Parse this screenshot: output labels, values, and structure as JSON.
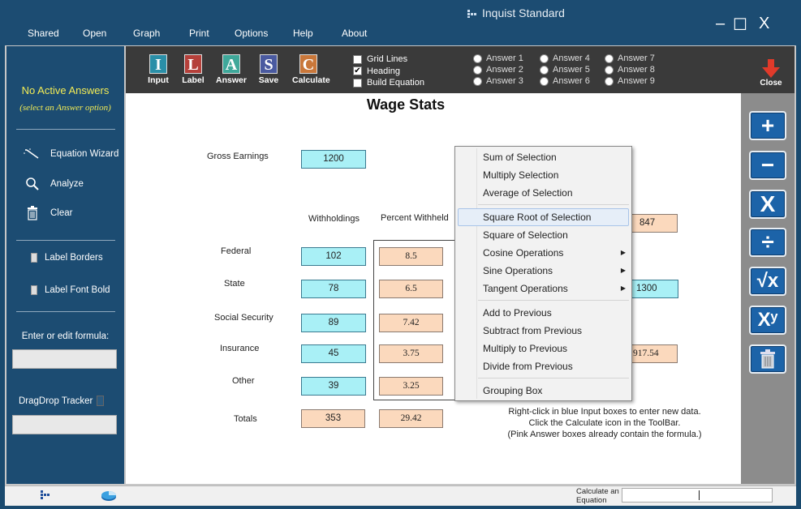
{
  "window": {
    "title": "Inquist Standard",
    "controls": {
      "minimize": "–",
      "maximize": "☐",
      "close": "X"
    }
  },
  "menu": [
    "Shared",
    "Open",
    "Graph",
    "Print",
    "Options",
    "Help",
    "About"
  ],
  "left_panel": {
    "status": "No Active Answers",
    "hint": "(select an Answer option)",
    "tools": [
      "Equation Wizard",
      "Analyze",
      "Clear"
    ],
    "toggles": [
      "Label Borders",
      "Label Font Bold"
    ],
    "formula_label": "Enter or edit formula:",
    "formula_value": "",
    "dragdrop_label": "DragDrop Tracker",
    "dragdrop_value": ""
  },
  "toolbar": {
    "tools": [
      {
        "letter": "I",
        "label": "Input",
        "color": "#2a8fa8"
      },
      {
        "letter": "L",
        "label": "Label",
        "color": "#b5403a"
      },
      {
        "letter": "A",
        "label": "Answer",
        "color": "#3fa89a"
      },
      {
        "letter": "S",
        "label": "Save",
        "color": "#4a5aa0"
      },
      {
        "letter": "C",
        "label": "Calculate",
        "color": "#c9773a"
      }
    ],
    "options": [
      {
        "label": "Grid Lines",
        "checked": false
      },
      {
        "label": "Heading",
        "checked": true
      },
      {
        "label": "Build Equation",
        "checked": false
      }
    ],
    "answers": [
      "Answer 1",
      "Answer 2",
      "Answer 3",
      "Answer 4",
      "Answer 5",
      "Answer 6",
      "Answer 7",
      "Answer 8",
      "Answer 9"
    ],
    "close_label": "Close"
  },
  "sheet": {
    "title": "Wage Stats",
    "gross_label": "Gross Earnings",
    "gross_value": "1200",
    "col_headers": [
      "Withholdings",
      "Percent Withheld"
    ],
    "rows": [
      {
        "label": "Federal",
        "amount": "102",
        "percent": "8.5"
      },
      {
        "label": "State",
        "amount": "78",
        "percent": "6.5"
      },
      {
        "label": "Social Security",
        "amount": "89",
        "percent": "7.42"
      },
      {
        "label": "Insurance",
        "amount": "45",
        "percent": "3.75"
      },
      {
        "label": "Other",
        "amount": "39",
        "percent": "3.25"
      }
    ],
    "totals": {
      "label": "Totals",
      "amount": "353",
      "percent": "29.42"
    },
    "right_cells": [
      "847",
      "1300",
      "917.54"
    ],
    "help": [
      "Right-click in blue Input boxes to enter new data.",
      "Click the Calculate icon in the ToolBar.",
      "(Pink Answer boxes already contain the formula.)"
    ]
  },
  "context_menu": {
    "groups": [
      [
        "Sum of Selection",
        "Multiply Selection",
        "Average of Selection"
      ],
      [
        "Square Root of Selection",
        "Square of Selection",
        "Cosine Operations",
        "Sine Operations",
        "Tangent Operations"
      ],
      [
        "Add to Previous",
        "Subtract from Previous",
        "Multiply to Previous",
        "Divide from Previous"
      ],
      [
        "Grouping Box"
      ]
    ],
    "highlighted": "Square Root of Selection",
    "submenu_items": [
      "Cosine Operations",
      "Sine Operations",
      "Tangent Operations"
    ]
  },
  "ops": [
    {
      "name": "plus",
      "glyph": "+"
    },
    {
      "name": "minus",
      "glyph": "−"
    },
    {
      "name": "multiply",
      "glyph": "X"
    },
    {
      "name": "divide",
      "glyph": "÷"
    },
    {
      "name": "sqrt",
      "glyph": "√x"
    },
    {
      "name": "power",
      "glyph": "Xʸ"
    },
    {
      "name": "trash",
      "glyph": ""
    }
  ],
  "statusbar": {
    "calc_label": "Calculate an Equation",
    "calc_value": ""
  }
}
